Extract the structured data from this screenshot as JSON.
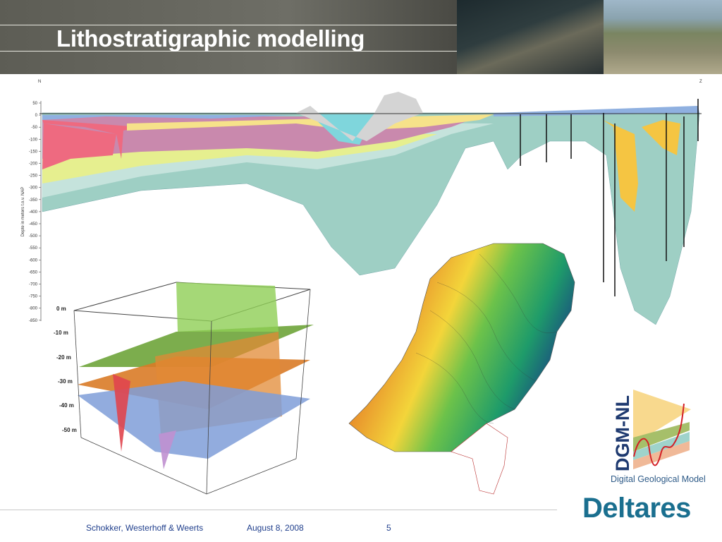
{
  "header": {
    "title": "Lithostratigraphic modelling"
  },
  "cross_section": {
    "north_label": "N",
    "south_label": "Z",
    "axis_label": "Depte in meters t.o.v. NAP",
    "ticks": [
      "50",
      "0",
      "-50",
      "-100",
      "-150",
      "-200",
      "-250",
      "-300",
      "-350",
      "-400",
      "-450",
      "-500",
      "-550",
      "-600",
      "-650",
      "-700",
      "-750",
      "-800",
      "-850"
    ]
  },
  "block_model": {
    "depth_labels": [
      "0 m",
      "-10 m",
      "-20 m",
      "-30 m",
      "-40 m",
      "-50 m"
    ]
  },
  "logos": {
    "dgm_text": "DGM-NL",
    "dgm_caption": "Digital Geological Model",
    "deltares": "Deltares"
  },
  "footer": {
    "authors": "Schokker, Westerhoff & Weerts",
    "date": "August 8, 2008",
    "page": "5"
  },
  "colors": {
    "title": "#ffffff",
    "footer_text": "#1f3e8c",
    "deltares": "#1a6f8f"
  }
}
